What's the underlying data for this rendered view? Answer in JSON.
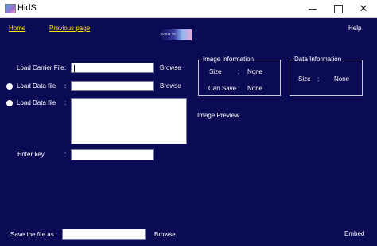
{
  "window": {
    "title": "HidS",
    "minimize_glyph": "",
    "maximize_glyph": "",
    "close_glyph": "✕"
  },
  "nav": {
    "home": "Home",
    "previous": "Previous page",
    "help": "Help",
    "logo_text": "20 ft of 7H"
  },
  "form": {
    "carrier_label": "Load Carrier File",
    "data_label_1": "Load Data file",
    "data_label_2": "Load Data file",
    "key_label": "Enter key",
    "colon": ":",
    "browse": "Browse",
    "carrier_value": "",
    "data_value": "",
    "data_text_value": "",
    "key_value": ""
  },
  "image_info": {
    "title": "Image information",
    "size_label": "Size",
    "size_value": "None",
    "can_save_label": "Can Save",
    "can_save_value": "None"
  },
  "data_info": {
    "title": "Data Information",
    "size_label": "Size",
    "size_value": "None"
  },
  "preview": {
    "label": "Image Preview"
  },
  "save": {
    "label": "Save the file as :",
    "value": "",
    "browse": "Browse",
    "embed": "Embed"
  },
  "colors": {
    "background": "#0a0a55",
    "link": "#ffe600",
    "text": "#ffffff"
  }
}
